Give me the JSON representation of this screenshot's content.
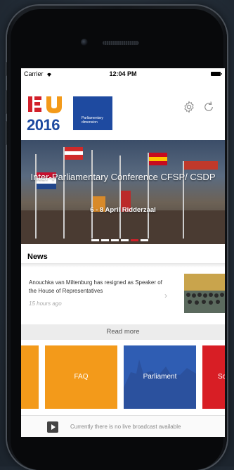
{
  "status_bar": {
    "carrier": "Carrier",
    "time": "12:04 PM"
  },
  "header": {
    "logo_year": "2016",
    "logo_box_text": "Parliamentary dimension"
  },
  "hero": {
    "title": "Inter-Parliamentary Conference CFSP/ CSDP",
    "subtitle": "6 - 8 April Ridderzaal",
    "slide_count": 6,
    "active_slide": 4
  },
  "news": {
    "heading": "News",
    "items": [
      {
        "headline": "Anouchka van Miltenburg has resigned as Speaker of the House of Representatives",
        "age": "15 hours ago"
      }
    ],
    "read_more": "Read more"
  },
  "tiles": [
    {
      "label": "",
      "color": "#f39a1a"
    },
    {
      "label": "FAQ",
      "color": "#f39a1a"
    },
    {
      "label": "Parliament",
      "color": "#2f5db3"
    },
    {
      "label": "Sc",
      "color": "#d81e25"
    }
  ],
  "footer": {
    "text": "Currently there is no live broadcast available"
  },
  "colors": {
    "brand_blue": "#1e4aa0",
    "accent_orange": "#f39a1a",
    "accent_red": "#d2202a"
  }
}
